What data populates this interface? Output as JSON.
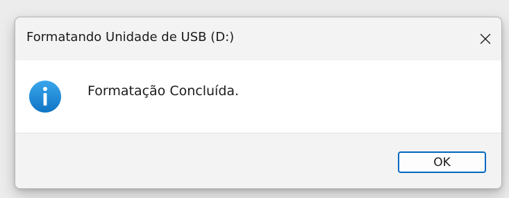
{
  "dialog": {
    "title": "Formatando Unidade de USB (D:)",
    "close_icon": "close-icon",
    "message": "Formatação Concluída.",
    "message_icon": "info-icon",
    "ok_label": "OK"
  },
  "colors": {
    "icon_blue": "#1e8bd6",
    "accent": "#0067c0",
    "content_bg": "#ffffff",
    "chrome_bg": "#f3f3f3"
  }
}
